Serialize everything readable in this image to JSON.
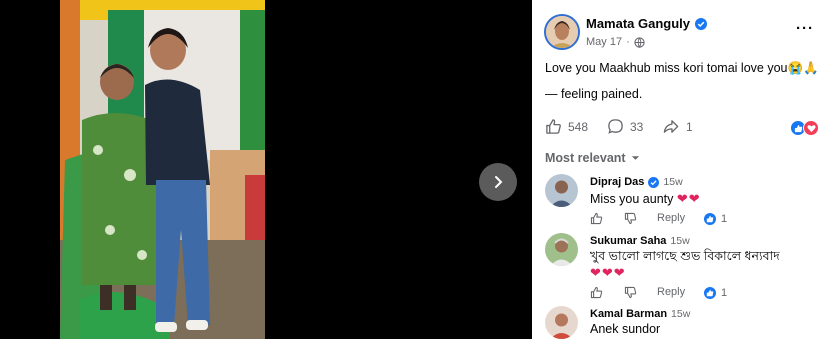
{
  "post": {
    "author": "Mamata Ganguly",
    "date": "May 17",
    "text_line1": "Love you Maakhub miss kori tomai love you😭🙏",
    "text_line2": "— feeling pained.",
    "likes": "548",
    "comments": "33",
    "shares": "1"
  },
  "sort_label": "Most relevant",
  "comments": [
    {
      "name": "Dipraj Das",
      "time": "15w",
      "text": "Miss you aunty",
      "hearts": "❤❤",
      "reply": "Reply",
      "reactions": "1"
    },
    {
      "name": "Sukumar Saha",
      "time": "15w",
      "text": "খুব ভালো লাগছে শুভ বিকালে ধন্যবাদ",
      "hearts": "❤❤❤",
      "reply": "Reply",
      "reactions": "1"
    },
    {
      "name": "Kamal Barman",
      "time": "15w",
      "text": "Anek sundor"
    }
  ],
  "icons": {
    "verified": "verified-badge-icon",
    "globe": "globe-icon",
    "like": "like-icon",
    "comment": "comment-icon",
    "share": "share-icon",
    "next": "chevron-right-icon"
  },
  "colors": {
    "brand_blue": "#1877f2",
    "love_red": "#f33e58",
    "meta_gray": "#65676b"
  }
}
